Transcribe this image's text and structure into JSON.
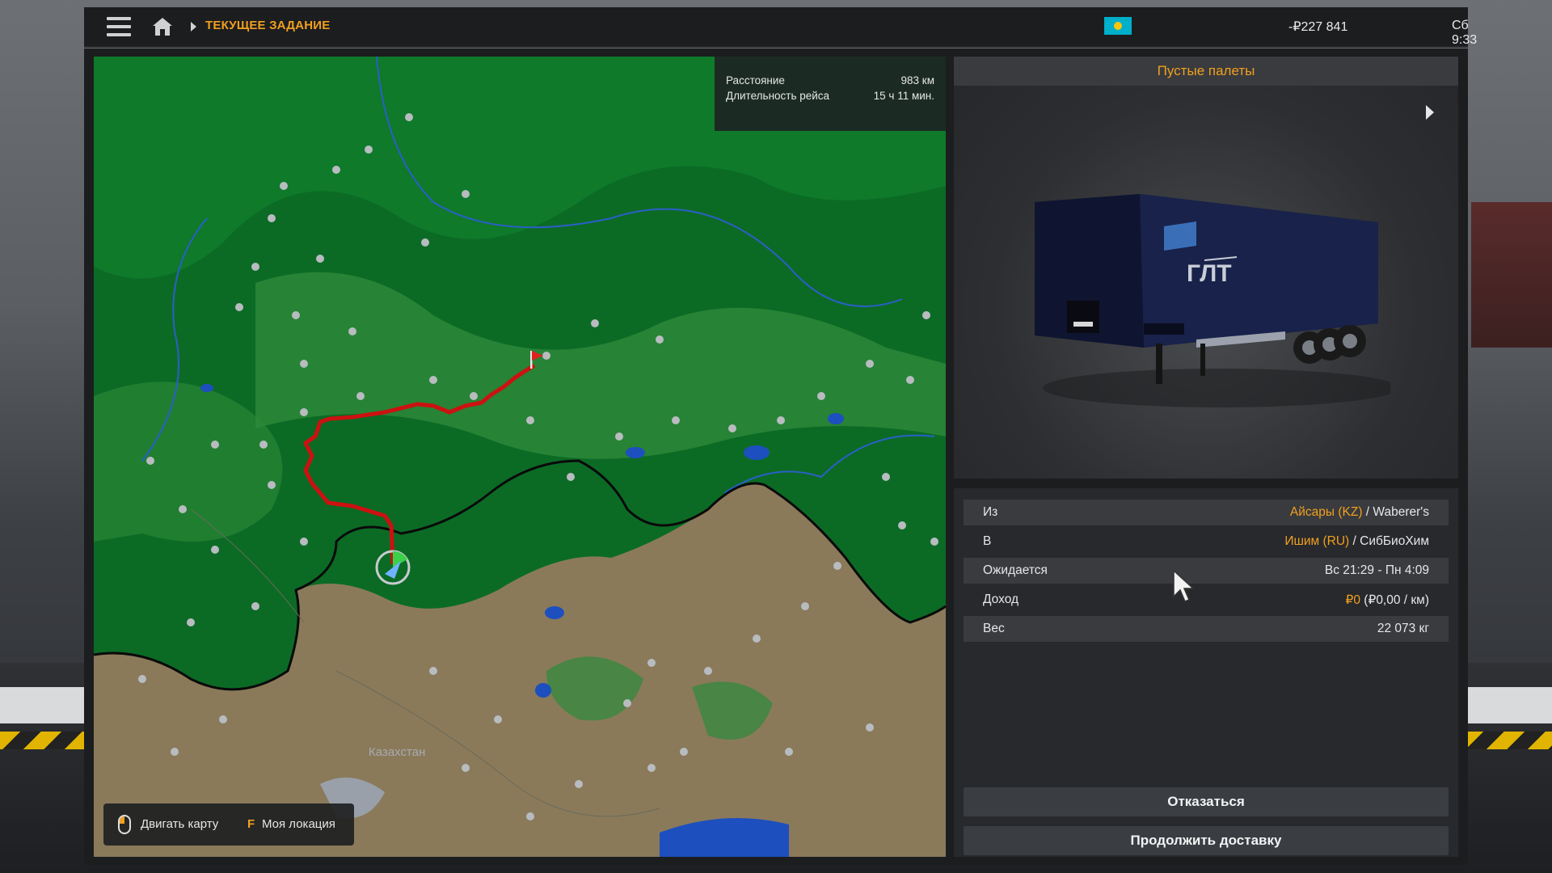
{
  "topbar": {
    "breadcrumb": "ТЕКУЩЕЕ ЗАДАНИЕ",
    "money": "-₽227 841",
    "clock": "Сб 9:33"
  },
  "map": {
    "distance_label": "Расстояние",
    "distance_value": "983 км",
    "duration_label": "Длительность рейса",
    "duration_value": "15 ч 11 мин.",
    "country_label": "Казахстан",
    "controls": {
      "move_label": "Двигать карту",
      "location_key": "F",
      "location_label": "Моя локация"
    }
  },
  "cargo": {
    "title": "Пустые палеты",
    "trailer_brand": "ГЛТ"
  },
  "details": {
    "from_label": "Из",
    "from_city": "Айсары (KZ)",
    "from_company": " / Waberer's",
    "to_label": "В",
    "to_city": "Ишим (RU)",
    "to_company": " / СибБиоХим",
    "expected_label": "Ожидается",
    "expected_value": "Вс 21:29 - Пн 4:09",
    "income_label": "Доход",
    "income_value": "₽0",
    "income_rate": " (₽0,00 / км)",
    "weight_label": "Вес",
    "weight_value": "22 073 кг"
  },
  "buttons": {
    "cancel": "Отказаться",
    "continue": "Продолжить доставку"
  },
  "colors": {
    "accent": "#f0a020",
    "route": "#cc1111",
    "forest": "#0b6b25",
    "steppe": "#8a7a5a"
  }
}
